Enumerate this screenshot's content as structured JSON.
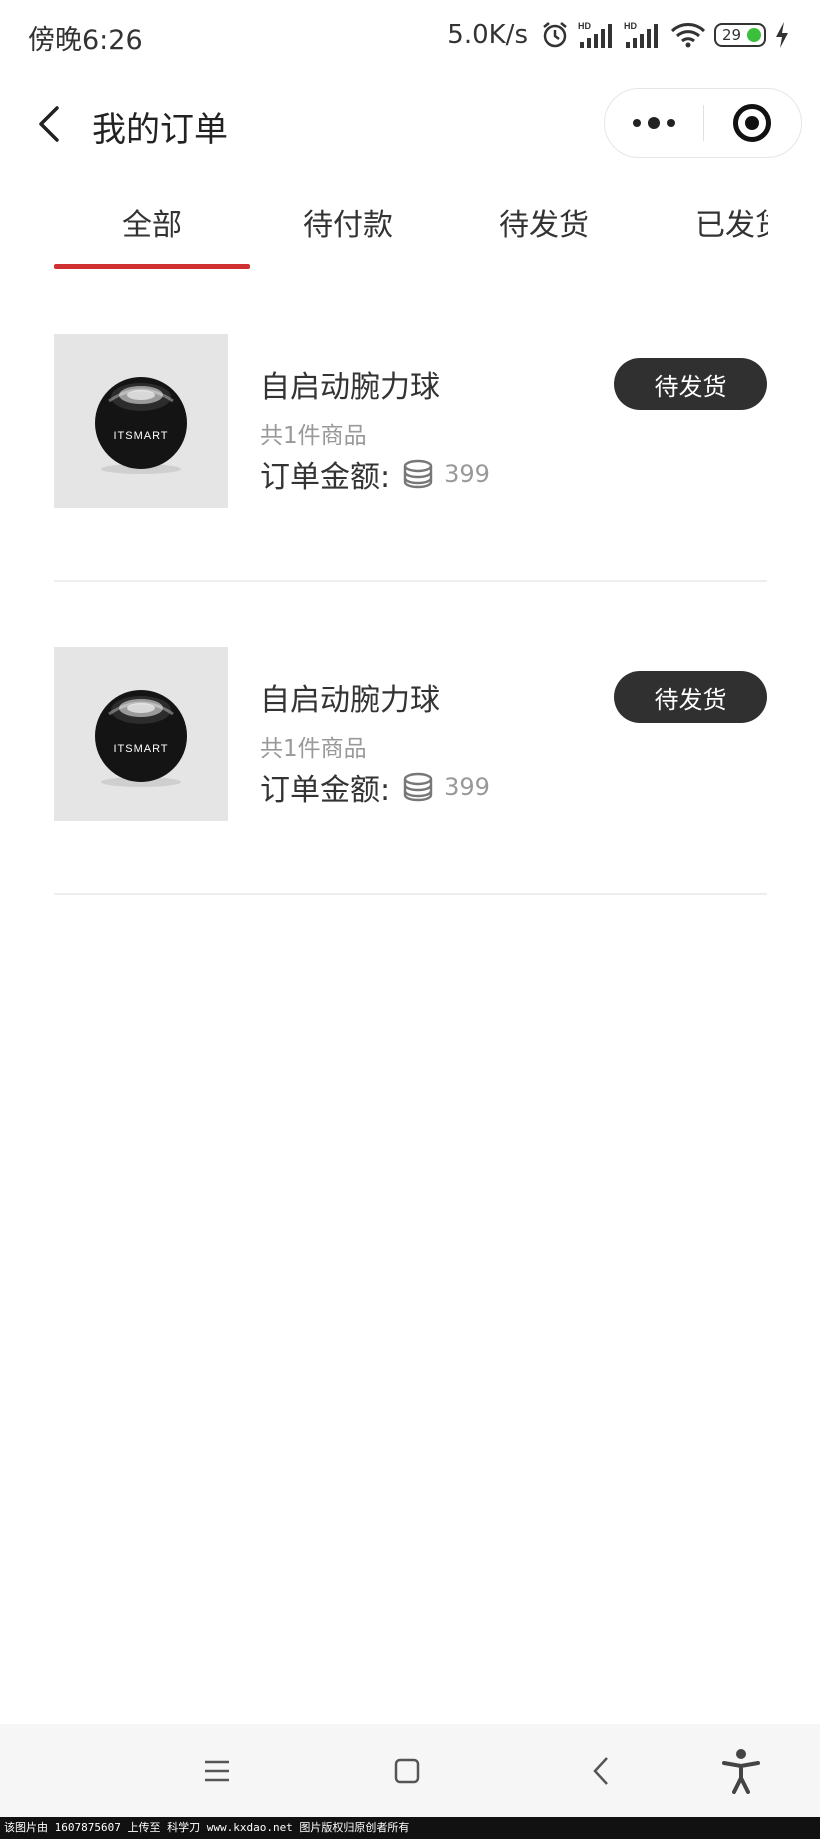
{
  "status_bar": {
    "time": "傍晚6:26",
    "net_speed": "5.0K/s",
    "battery": "29",
    "icons": [
      "alarm-icon",
      "signal-hd-icon",
      "signal-hd-icon",
      "wifi-icon",
      "battery-icon",
      "charging-icon"
    ]
  },
  "nav": {
    "title": "我的订单",
    "back_icon": "chevron-left-icon",
    "more_icon": "more-dots-icon",
    "close_icon": "target-icon"
  },
  "tabs": {
    "items": [
      "全部",
      "待付款",
      "待发货",
      "已发货"
    ],
    "active_index": 0,
    "active_color": "#d0302f"
  },
  "orders": [
    {
      "name": "自启动腕力球",
      "count_text": "共1件商品",
      "amount_label": "订单金额:",
      "amount_value": "399",
      "status": "待发货",
      "product_brand": "ITSMART"
    },
    {
      "name": "自启动腕力球",
      "count_text": "共1件商品",
      "amount_label": "订单金额:",
      "amount_value": "399",
      "status": "待发货",
      "product_brand": "ITSMART"
    }
  ],
  "system_nav": {
    "icons": [
      "menu-icon",
      "home-square-icon",
      "back-chevron-icon",
      "accessibility-icon"
    ]
  },
  "watermark": "该图片由 1607875607 上传至 科学刀 www.kxdao.net 图片版权归原创者所有"
}
